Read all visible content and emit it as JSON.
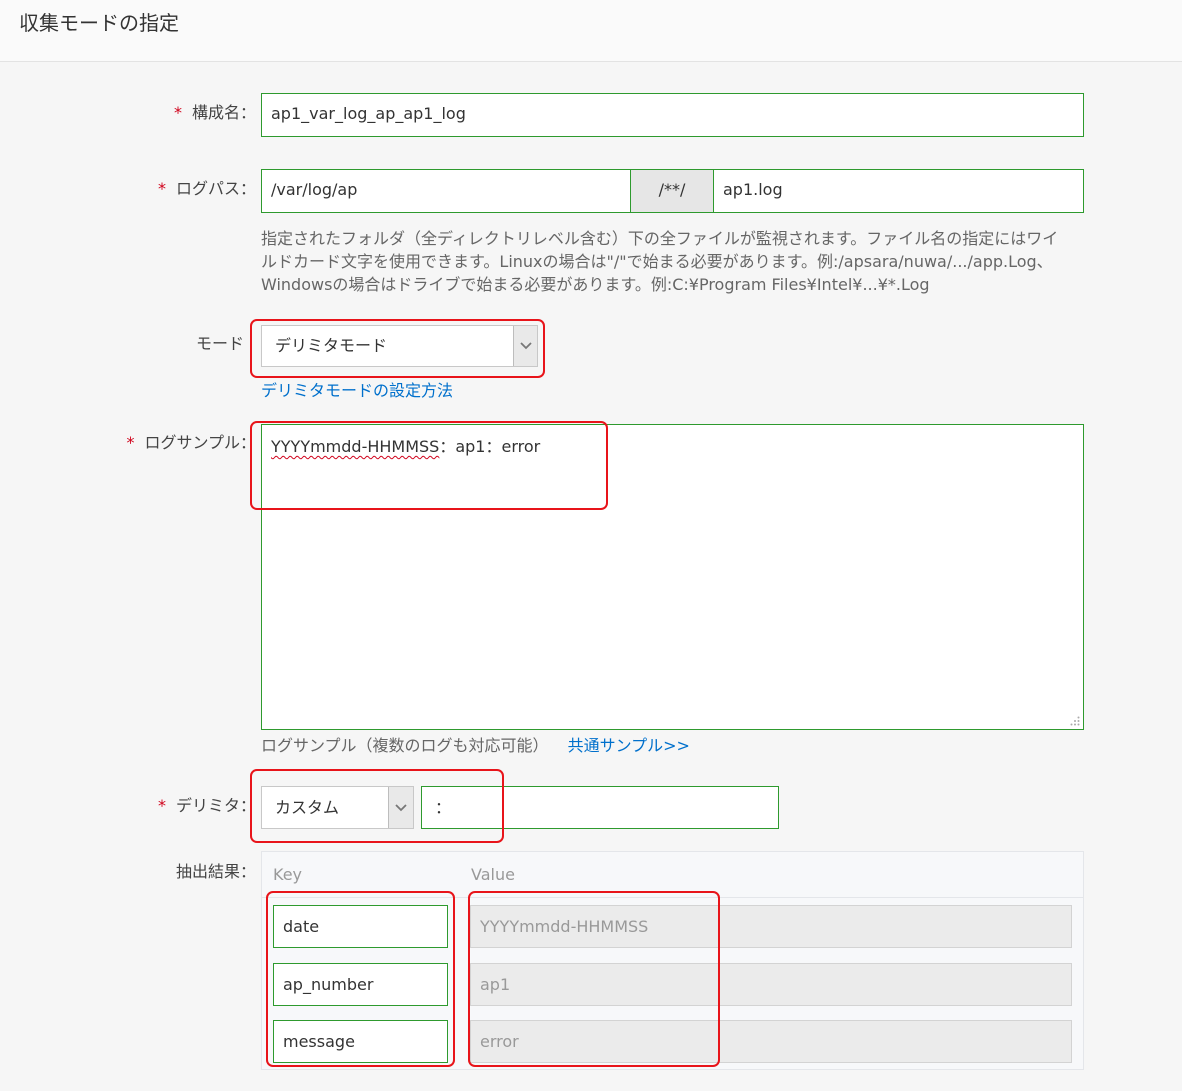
{
  "header": {
    "title": "収集モードの指定"
  },
  "form": {
    "config_name": {
      "required_mark": "*",
      "label": "構成名：",
      "value": "ap1_var_log_ap_ap1_log"
    },
    "log_path": {
      "required_mark": "*",
      "label": "ログパス：",
      "folder_value": "/var/log/ap",
      "separator": "/**/",
      "file_value": "ap1.log",
      "help_lines": [
        "指定されたフォルダ（全ディレクトリレベル含む）下の全ファイルが監視されます。ファイル名の指定にはワイ",
        "ルドカード文字を使用できます。Linuxの場合は\"/\"で始まる必要があります。例:/apsara/nuwa/.../app.Log、",
        "Windowsの場合はドライブで始まる必要があります。例:C:¥Program Files¥Intel¥...¥*.Log"
      ]
    },
    "mode": {
      "label": "モード",
      "selected": "デリミタモード",
      "help_link": "デリミタモードの設定方法"
    },
    "log_sample": {
      "required_mark": "*",
      "label": "ログサンプル：",
      "value_timestamp": "YYYYmmdd-HHMMSS",
      "value_rest": "：ap1：error",
      "help_text": "ログサンプル（複数のログも対応可能）",
      "help_link": "共通サンプル>>"
    },
    "delimiter": {
      "required_mark": "*",
      "label": "デリミタ：",
      "selected": "カスタム",
      "custom_value": "："
    },
    "extraction_result": {
      "label": "抽出結果：",
      "key_header": "Key",
      "value_header": "Value",
      "rows": [
        {
          "key": "date",
          "value": "YYYYmmdd-HHMMSS"
        },
        {
          "key": "ap_number",
          "value": "ap1"
        },
        {
          "key": "message",
          "value": "error"
        }
      ]
    }
  },
  "icons": {
    "select_arrow": "chevron-down-icon",
    "resize": "resize-grip-icon"
  },
  "colors": {
    "valid_border": "#2e9a2e",
    "required": "#d0021b",
    "link": "#0070cc",
    "highlight": "#e8141a"
  }
}
